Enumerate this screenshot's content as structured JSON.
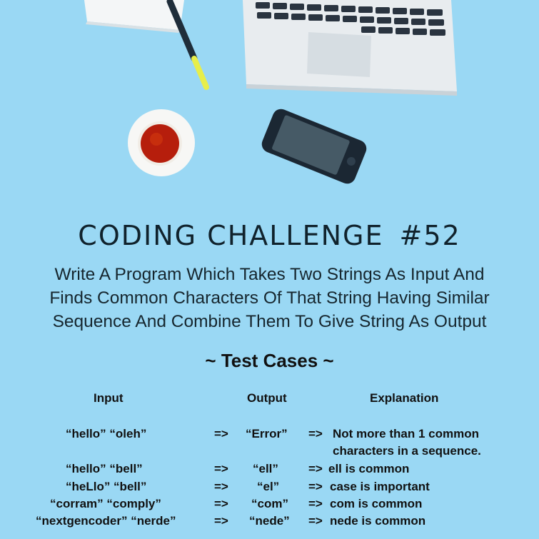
{
  "headline": {
    "title": "CODING CHALLENGE",
    "number": "#52"
  },
  "description": [
    "Write A Program Which Takes Two Strings As Input And",
    "Finds Common Characters Of That String Having Similar",
    "Sequence And Combine Them To Give String As Output"
  ],
  "test_cases_title": "~ Test Cases ~",
  "columns": {
    "input": "Input",
    "output": "Output",
    "explanation": "Explanation"
  },
  "rows": [
    {
      "input": "“hello”  “oleh”",
      "arrow1": "=>",
      "output": "“Error”",
      "arrow2": "=>",
      "explanation": "Not more than 1 common",
      "explanation_line2": "characters in a sequence."
    },
    {
      "input": "“hello”  “bell”",
      "arrow1": "=>",
      "output": "“ell”",
      "arrow2": "=>",
      "explanation": "ell is common"
    },
    {
      "input": "“heLlo”  “bell”",
      "arrow1": "=>",
      "output": "“el”",
      "arrow2": "=>",
      "explanation": "case is important"
    },
    {
      "input": "“corram”  “comply”",
      "arrow1": "=>",
      "output": "“com”",
      "arrow2": "=>",
      "explanation": "com is common"
    },
    {
      "input": "“nextgencoder”  “nerde”",
      "arrow1": "=>",
      "output": "“nede”",
      "arrow2": "=>",
      "explanation": "nede is common"
    }
  ]
}
